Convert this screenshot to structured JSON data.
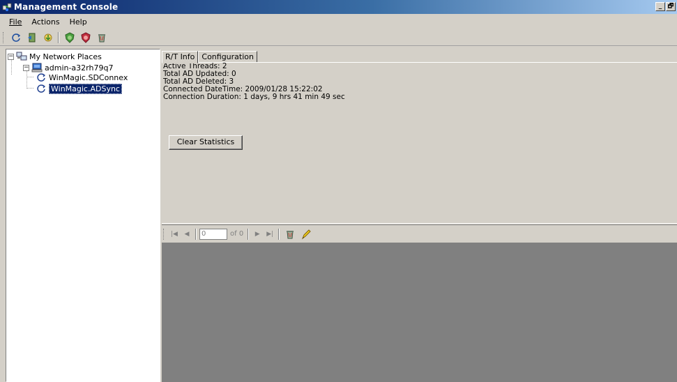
{
  "window": {
    "title": "Management Console",
    "minimize": "_",
    "restore": "🗗"
  },
  "menu": {
    "items": [
      {
        "label": "File",
        "accel": "F"
      },
      {
        "label": "Actions",
        "accel": "A"
      },
      {
        "label": "Help",
        "accel": "H"
      }
    ]
  },
  "toolbar": {
    "icons": [
      "refresh-icon",
      "exit-icon",
      "download-icon",
      "start-shield-icon",
      "stop-shield-icon",
      "trash-icon"
    ]
  },
  "tree": {
    "root": "My Network Places",
    "host": "admin-a32rh79q7",
    "children": [
      "WinMagic.SDConnex",
      "WinMagic.ADSync"
    ],
    "expander_open": "−"
  },
  "tabs": [
    "R/T Info",
    "Configuration"
  ],
  "info": {
    "lines": [
      "Active Threads: 2",
      "Total AD Updated: 0",
      "Total AD Deleted: 3",
      "Connected DateTime: 2009/01/28 15:22:02",
      "Connection Duration: 1 days, 9 hrs 41 min 49 sec"
    ],
    "clear_button": "Clear Statistics"
  },
  "navigator": {
    "position_value": "0",
    "of_label": "of 0",
    "first": "|◀",
    "prev": "◀",
    "next": "▶",
    "last": "▶|"
  },
  "colors": {
    "titlebar_start": "#0a246a",
    "titlebar_end": "#a6caf0",
    "selection": "#0a246a",
    "grid_background": "#808080",
    "face": "#d4d0c8"
  }
}
